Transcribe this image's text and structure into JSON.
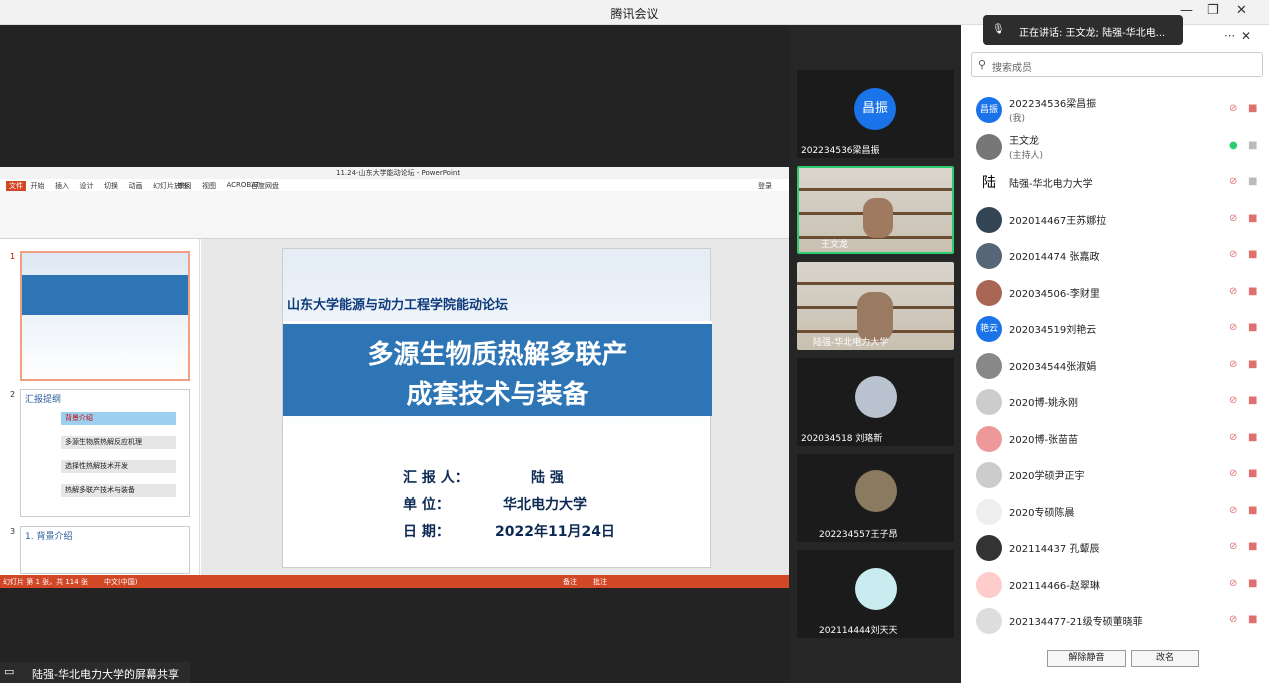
{
  "window": {
    "title": "腾讯会议"
  },
  "speaking": {
    "label": "正在讲话: 王文龙; 陆强-华北电..."
  },
  "share_bar": {
    "label": "陆强-华北电力大学的屏幕共享"
  },
  "ppt": {
    "window_title": "11.24-山东大学能动论坛 - PowerPoint",
    "ribbon_tabs": [
      "文件",
      "开始",
      "插入",
      "设计",
      "切换",
      "动画",
      "幻灯片放映",
      "审阅",
      "视图",
      "ACROBAT",
      "百度网盘"
    ],
    "login": "登录",
    "slide_thumbs": {
      "n1": "1",
      "n2": "2",
      "n3": "3",
      "t2": "汇报提纲",
      "items": [
        "背景介绍",
        "多源生物质热解反应机理",
        "选择性热解技术开发",
        "热解多联产技术与装备"
      ],
      "t3": "1. 背景介绍"
    },
    "slide": {
      "header": "山东大学能源与动力工程学院能动论坛",
      "title1": "多源生物质热解多联产",
      "title2": "成套技术与装备",
      "reporter_label": "汇 报 人：",
      "reporter": "陆  强",
      "unit_label": "单    位：",
      "unit": "华北电力大学",
      "date_label": "日    期：",
      "date": "2022年11月24日"
    },
    "status": {
      "left": "幻灯片 第 1 张，共 114 张",
      "lang": "中文(中国)",
      "notes": "备注",
      "comments": "批注"
    }
  },
  "videos": [
    {
      "name": "202234536梁昌振",
      "avatar": "昌振"
    },
    {
      "name": "王文龙"
    },
    {
      "name": "陆强-华北电力大学"
    },
    {
      "name": "202034518 刘珞新"
    },
    {
      "name": "202234557王子昂"
    },
    {
      "name": "202114444刘天天"
    }
  ],
  "panel": {
    "search_placeholder": "搜索成员",
    "members": [
      {
        "name": "202234536梁昌振",
        "sub": "(我)",
        "avatar": "昌振",
        "color": "#1a73e8"
      },
      {
        "name": "王文龙",
        "sub": "(主持人)",
        "avatar": "",
        "color": "#777"
      },
      {
        "name": "陆强-华北电力大学",
        "sub": "",
        "avatar": "陆",
        "color": "#fff"
      },
      {
        "name": "202014467王苏娜拉",
        "sub": "",
        "avatar": "",
        "color": "#345"
      },
      {
        "name": "202014474 张嘉政",
        "sub": "",
        "avatar": "",
        "color": "#567"
      },
      {
        "name": "202034506-李财里",
        "sub": "",
        "avatar": "",
        "color": "#a65"
      },
      {
        "name": "202034519刘艳云",
        "sub": "",
        "avatar": "艳云",
        "color": "#1a73e8"
      },
      {
        "name": "202034544张淑娟",
        "sub": "",
        "avatar": "",
        "color": "#888"
      },
      {
        "name": "2020博-姚永刚",
        "sub": "",
        "avatar": "",
        "color": "#ccc"
      },
      {
        "name": "2020博-张苗苗",
        "sub": "",
        "avatar": "",
        "color": "#e99"
      },
      {
        "name": "2020学硕尹正宇",
        "sub": "",
        "avatar": "",
        "color": "#ccc"
      },
      {
        "name": "2020专硕陈晨",
        "sub": "",
        "avatar": "",
        "color": "#eee"
      },
      {
        "name": "202114437 孔颦辰",
        "sub": "",
        "avatar": "",
        "color": "#333"
      },
      {
        "name": "202114466-赵翠琳",
        "sub": "",
        "avatar": "",
        "color": "#fcc"
      },
      {
        "name": "202134477-21级专硕董晓菲",
        "sub": "",
        "avatar": "",
        "color": "#ddd"
      }
    ],
    "btn_unmute": "解除静音",
    "btn_rename": "改名"
  }
}
